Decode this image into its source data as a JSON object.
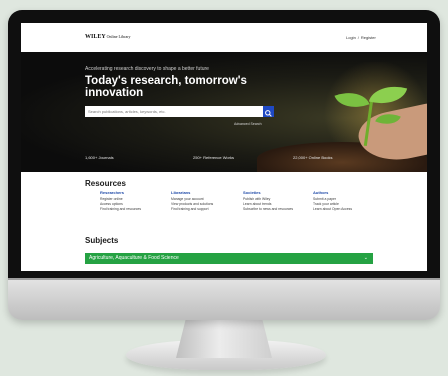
{
  "header": {
    "logo_main": "WILEY",
    "logo_sub": "Online Library",
    "login": "Login",
    "separator": "/",
    "register": "Register"
  },
  "hero": {
    "tagline": "Accelerating research discovery to shape a better future",
    "title": "Today's research, tomorrow's innovation",
    "search_placeholder": "Search publications, articles, keywords, etc.",
    "advanced_search": "Advanced Search",
    "stats": [
      "1,600+ Journals",
      "250+ Reference Works",
      "22,000+ Online Books"
    ]
  },
  "resources": {
    "title": "Resources",
    "columns": [
      {
        "heading": "Researchers",
        "links": [
          "Register online",
          "Access options",
          "Find training and resources"
        ]
      },
      {
        "heading": "Librarians",
        "links": [
          "Manage your account",
          "View products and solutions",
          "Find training and support"
        ]
      },
      {
        "heading": "Societies",
        "links": [
          "Publish with Wiley",
          "Learn about trends",
          "Subscribe to news and resources"
        ]
      },
      {
        "heading": "Authors",
        "links": [
          "Submit a paper",
          "Track your article",
          "Learn about Open Access"
        ]
      }
    ]
  },
  "subjects": {
    "title": "Subjects",
    "first_item": "Agriculture, Aquaculture & Food Science"
  },
  "colors": {
    "accent_blue": "#1f49c4",
    "subject_green": "#25a243",
    "page_background": "#dfe7df"
  },
  "icons": {
    "search": "search-icon",
    "chevron": "chevron-down-icon"
  }
}
